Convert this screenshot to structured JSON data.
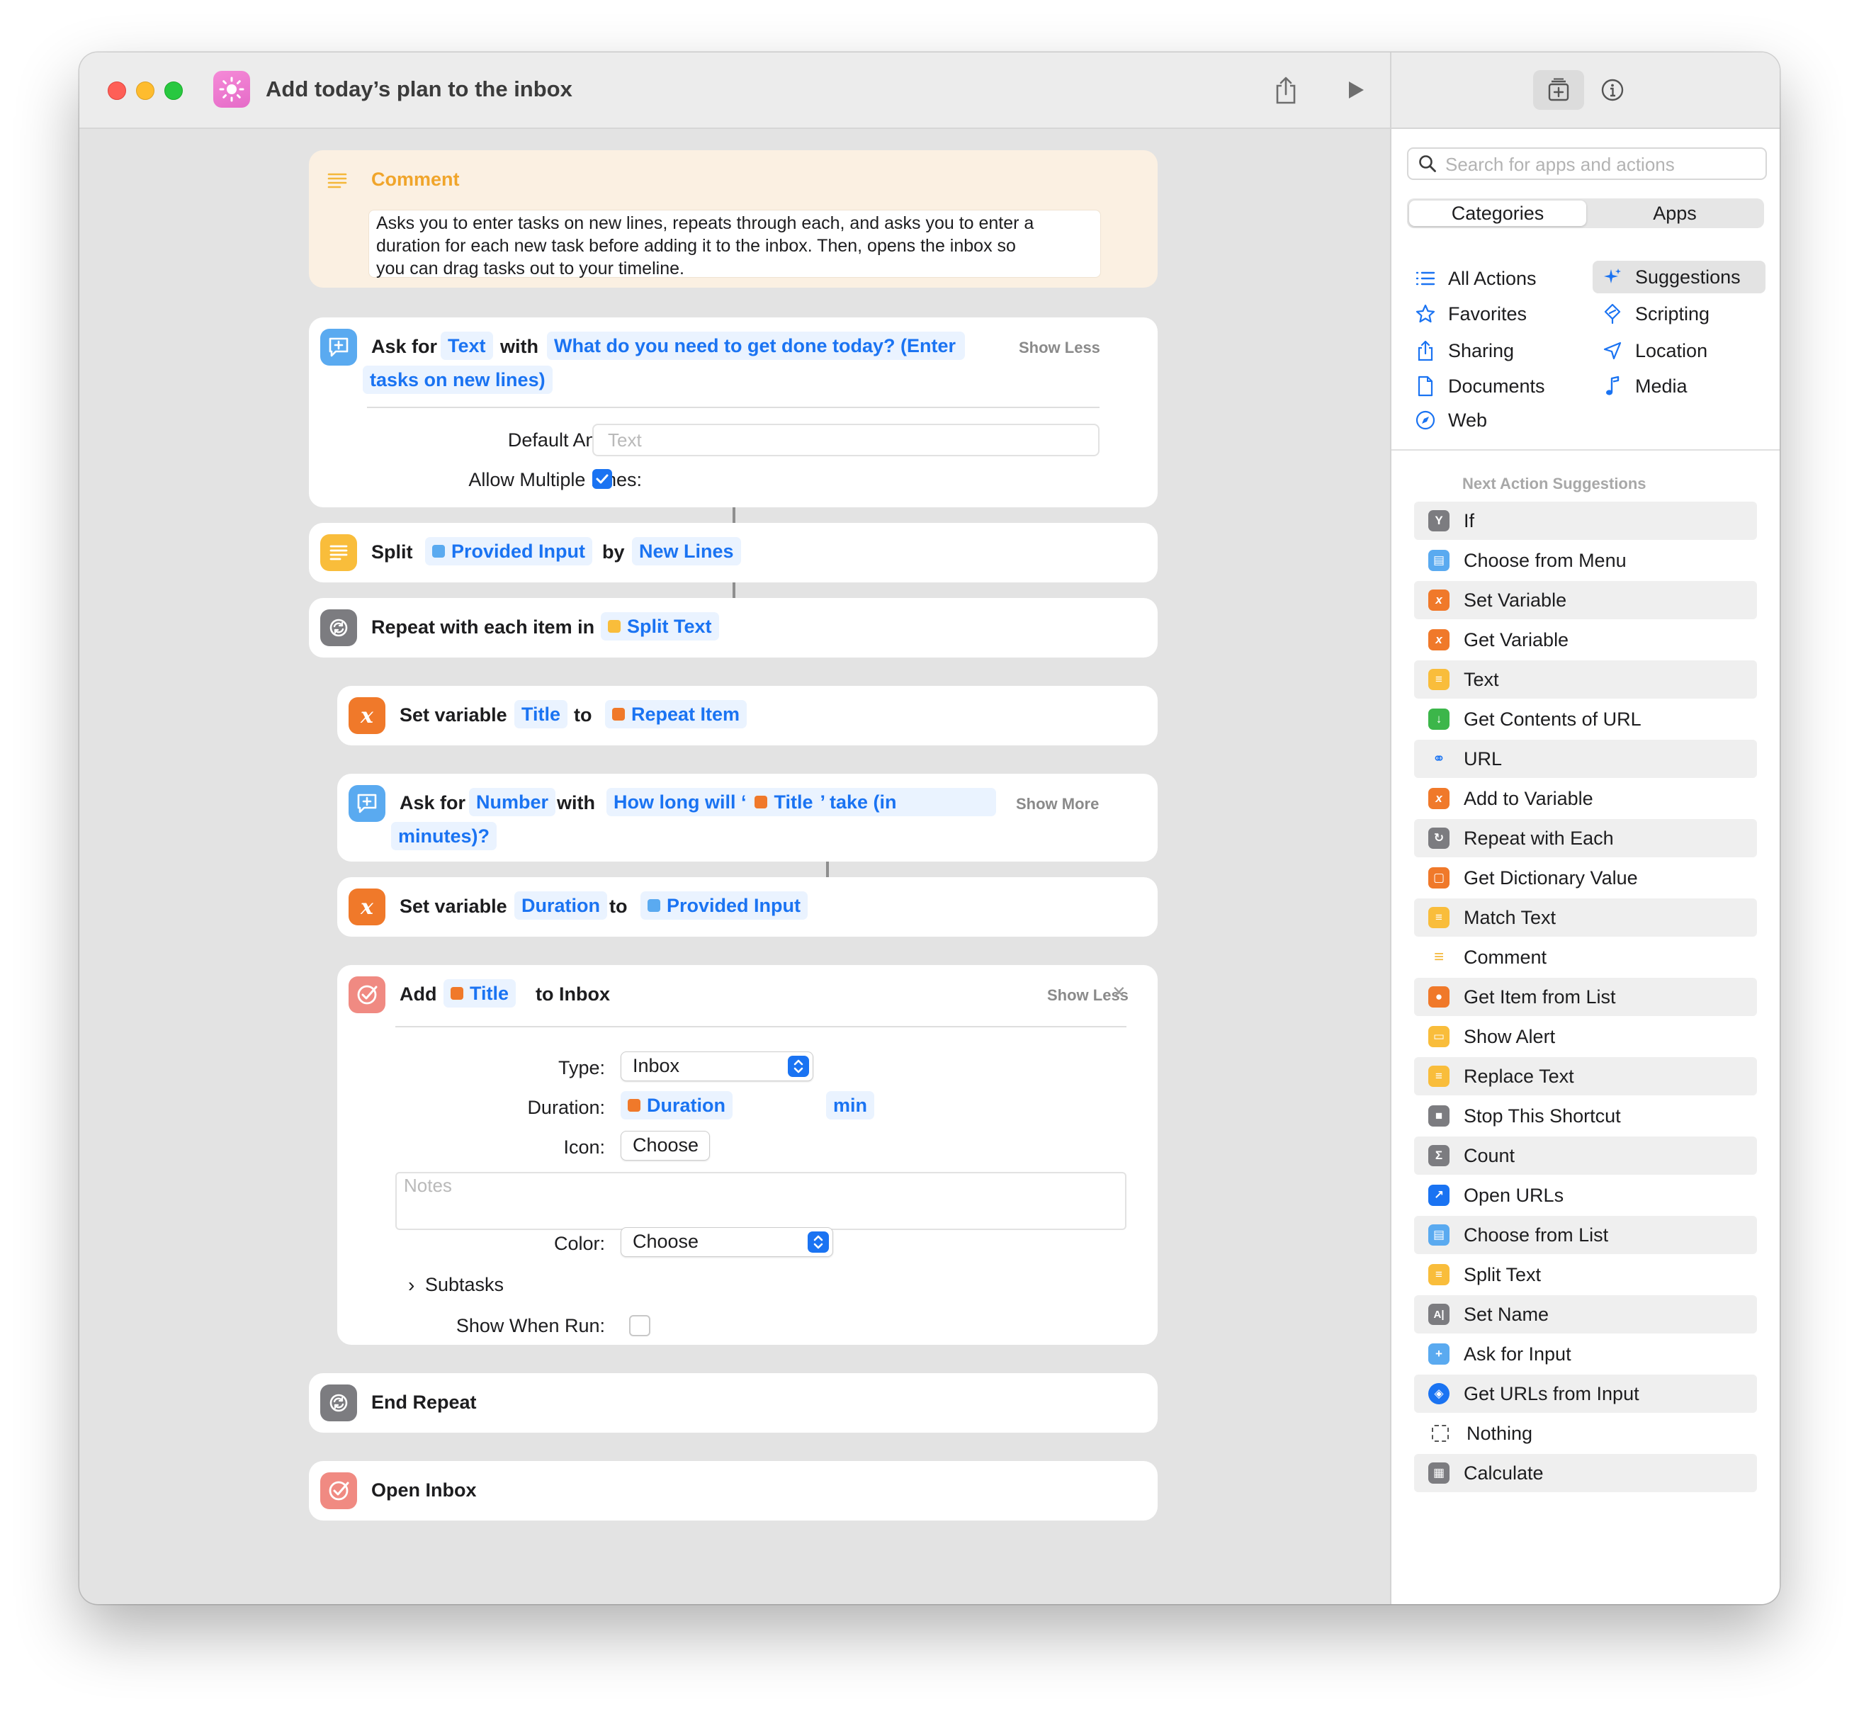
{
  "window": {
    "title": "Add today’s plan to the inbox"
  },
  "editor": {
    "comment": {
      "heading": "Comment",
      "body_lines": [
        "Asks you to enter tasks on new lines, repeats through each, and asks you to enter a",
        "duration for each new task before adding it to the inbox. Then, opens the inbox so",
        "you can drag tasks out to your timeline."
      ]
    },
    "ask_text": {
      "prefix": "Ask for",
      "type_token": "Text",
      "with": "with",
      "prompt_line1": "What do you need to get done today? (Enter",
      "prompt_line2": "tasks on new lines)",
      "toggle": "Show Less",
      "default_answer_label": "Default Answer:",
      "default_answer_placeholder": "Text",
      "multiline_label": "Allow Multiple Lines:",
      "multiline_checked": true
    },
    "split": {
      "prefix": "Split",
      "input_token": "Provided Input",
      "by": "by",
      "separator_token": "New Lines"
    },
    "repeat": {
      "prefix": "Repeat with each item in",
      "token": "Split Text"
    },
    "set_title": {
      "prefix": "Set variable",
      "var_token": "Title",
      "to": "to",
      "value_token": "Repeat Item"
    },
    "ask_number": {
      "prefix": "Ask for",
      "type_token": "Number",
      "with": "with",
      "prompt_a": "How long will ‘",
      "prompt_var": "Title",
      "prompt_b": "’ take (in",
      "prompt_line2": "minutes)?",
      "toggle": "Show More"
    },
    "set_duration": {
      "prefix": "Set variable",
      "var_token": "Duration",
      "to": "to",
      "value_token": "Provided Input"
    },
    "add_inbox": {
      "prefix": "Add",
      "title_token": "Title",
      "suffix": "to Inbox",
      "toggle": "Show Less",
      "close_glyph": "×",
      "type_label": "Type:",
      "type_value": "Inbox",
      "duration_label": "Duration:",
      "duration_token": "Duration",
      "duration_unit": "min",
      "icon_label": "Icon:",
      "icon_button": "Choose",
      "notes_placeholder": "Notes",
      "color_label": "Color:",
      "color_value": "Choose",
      "subtasks_chevron": "›",
      "subtasks_label": "Subtasks",
      "show_when_run_label": "Show When Run:",
      "show_when_run_checked": false
    },
    "end_repeat": {
      "label": "End Repeat"
    },
    "open_inbox": {
      "label": "Open Inbox"
    }
  },
  "sidebar": {
    "search_placeholder": "Search for apps and actions",
    "segments": [
      "Categories",
      "Apps"
    ],
    "categories_left": [
      "All Actions",
      "Favorites",
      "Sharing",
      "Documents",
      "Web"
    ],
    "categories_right": [
      "Suggestions",
      "Scripting",
      "Location",
      "Media"
    ],
    "selected_category": "Suggestions",
    "suggestions_heading": "Next Action Suggestions",
    "suggestions": [
      "If",
      "Choose from Menu",
      "Set Variable",
      "Get Variable",
      "Text",
      "Get Contents of URL",
      "URL",
      "Add to Variable",
      "Repeat with Each",
      "Get Dictionary Value",
      "Match Text",
      "Comment",
      "Get Item from List",
      "Show Alert",
      "Replace Text",
      "Stop This Shortcut",
      "Count",
      "Open URLs",
      "Choose from List",
      "Split Text",
      "Set Name",
      "Ask for Input",
      "Get URLs from Input",
      "Nothing",
      "Calculate"
    ]
  },
  "colors": {
    "accent_blue": "#1a73f2",
    "token_bg": "#eaf3ff",
    "comment_bg": "#fbf0e2",
    "comment_accent": "#f4b73a",
    "variable_orange": "#f0792a",
    "ask_blue": "#5aaaf0",
    "text_yellow": "#f9bd3b",
    "repeat_gray": "#7c7c80",
    "inbox_red": "#f08a82"
  },
  "icons": {
    "titlebar": [
      "app-sun-icon",
      "share-icon",
      "play-icon",
      "add-action-icon",
      "info-icon"
    ],
    "categories": [
      "list-icon",
      "star-icon",
      "share-icon",
      "document-icon",
      "compass-icon",
      "sparkle-icon",
      "scripting-icon",
      "location-arrow-icon",
      "music-note-icon"
    ]
  }
}
